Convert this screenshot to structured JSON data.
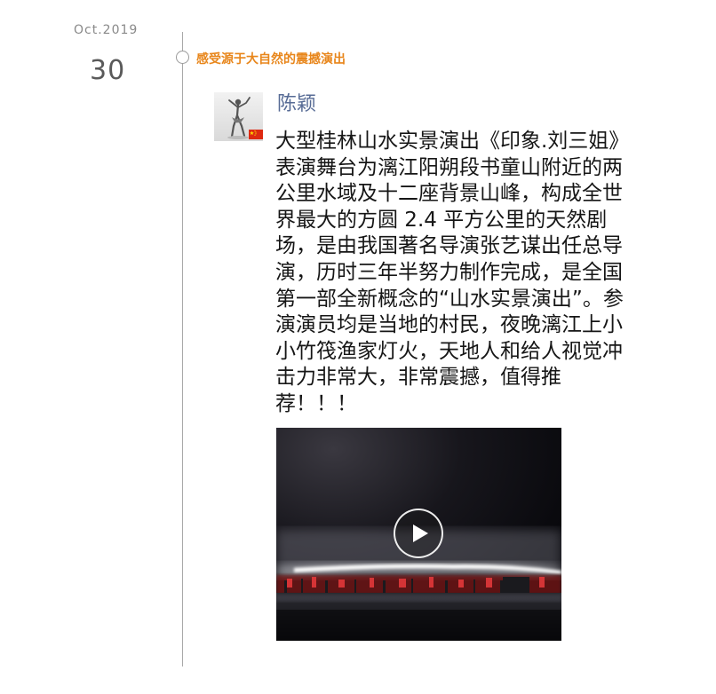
{
  "date": {
    "month_year": "Oct.2019",
    "day": "30"
  },
  "timeline": {
    "title": "感受源于大自然的震撼演出",
    "node_icon": "timeline-node-circle"
  },
  "post": {
    "author": "陈颖",
    "avatar_icon": "dancer-avatar-icon",
    "flag_icon": "china-flag-icon",
    "lines": [
      "大型桂林山水实景演出《印象.刘三姐》",
      "表演舞台为漓江阳朔段书童山附近的两",
      "公里水域及十二座背景山峰，构成全世",
      "界最大的方圆 2.4 平方公里的天然剧",
      "场，是由我国著名导演张艺谋出任总导",
      "演，历时三年半努力制作完成，是全国",
      "第一部全新概念的“山水实景演出”。参",
      "演演员均是当地的村民，夜晚漓江上小",
      "小竹筏渔家灯火，天地人和给人视觉冲",
      "击力非常大，非常震撼，值得推",
      "荐！！！"
    ]
  },
  "video": {
    "play_icon": "play-icon"
  },
  "colors": {
    "title_accent": "#e8861b",
    "author_name": "#576b95",
    "body_text": "#161616",
    "muted": "#8a8a8a"
  }
}
